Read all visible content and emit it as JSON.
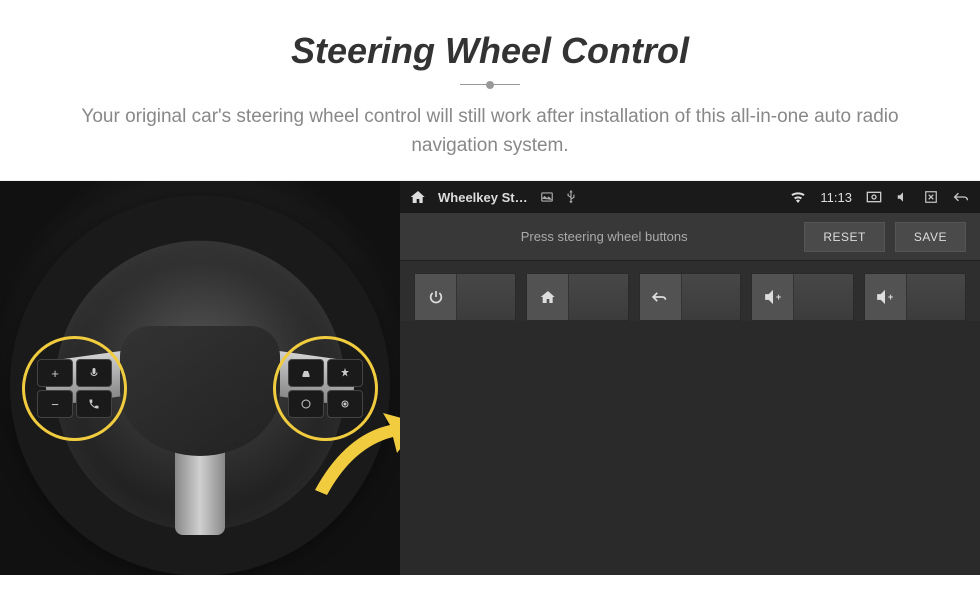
{
  "header": {
    "title": "Steering Wheel Control",
    "description": "Your original car's steering wheel control will still work after installation of this all-in-one auto radio navigation system."
  },
  "steering": {
    "left_buttons": [
      "+",
      "voice",
      "−",
      "phone"
    ],
    "right_buttons": [
      "car",
      "nav",
      "circle",
      "target"
    ]
  },
  "statusbar": {
    "app_title": "Wheelkey St…",
    "time": "11:13",
    "icons": {
      "home": "home",
      "picture": "picture",
      "usb": "usb",
      "wifi": "wifi",
      "screen": "screen",
      "mute": "mute",
      "close": "close",
      "back": "back"
    }
  },
  "toolbar": {
    "prompt": "Press steering wheel buttons",
    "reset_label": "RESET",
    "save_label": "SAVE"
  },
  "functions": {
    "items": [
      {
        "name": "power"
      },
      {
        "name": "home"
      },
      {
        "name": "back"
      },
      {
        "name": "volume-up-1"
      },
      {
        "name": "volume-up-2"
      }
    ]
  },
  "colors": {
    "accent": "#f0cc3e",
    "bg_dark": "#2e2e2e"
  }
}
